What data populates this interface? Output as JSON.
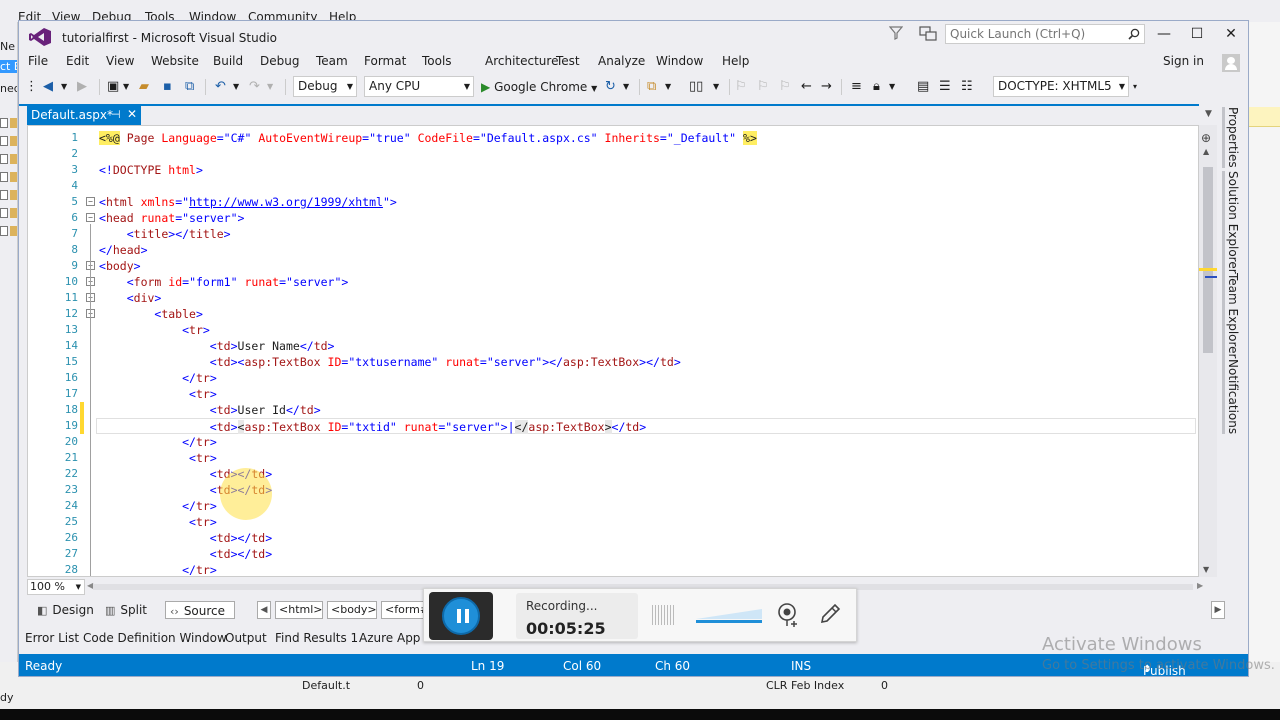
{
  "background_window": {
    "menu": [
      "Edit",
      "View",
      "Debug",
      "Tools",
      "Window",
      "Community",
      "Help"
    ],
    "left_fragments": [
      "Ne",
      "ct E",
      "ned"
    ],
    "bottom_fragments": [
      "dy",
      "Default.t",
      "0",
      "CLR Feb Index",
      "0"
    ]
  },
  "titlebar": {
    "title": "tutorialfirst - Microsoft Visual Studio",
    "quick_launch_placeholder": "Quick Launch (Ctrl+Q)",
    "minimize": "—",
    "maximize": "☐",
    "close": "✕"
  },
  "menubar": {
    "items": [
      "File",
      "Edit",
      "View",
      "Website",
      "Build",
      "Debug",
      "Team",
      "Format",
      "Tools",
      "Architecture",
      "Test",
      "Analyze",
      "Window",
      "Help"
    ],
    "sign_in": "Sign in"
  },
  "toolbar": {
    "config": "Debug",
    "platform": "Any CPU",
    "run_target": "Google Chrome",
    "doctype": "DOCTYPE: XHTML5"
  },
  "doc_tab": {
    "name": "Default.aspx*",
    "pin": "⊣",
    "close": "✕"
  },
  "editor": {
    "line_numbers": [
      "1",
      "2",
      "3",
      "4",
      "5",
      "6",
      "7",
      "8",
      "9",
      "10",
      "11",
      "12",
      "13",
      "14",
      "15",
      "16",
      "17",
      "18",
      "19",
      "20",
      "21",
      "22",
      "23",
      "24",
      "25",
      "26",
      "27",
      "28"
    ],
    "lines": [
      [
        [
          "c-dir",
          "<%@"
        ],
        [
          "c-black",
          " "
        ],
        [
          "c-maroon",
          "Page"
        ],
        [
          "c-black",
          " "
        ],
        [
          "c-red",
          "Language"
        ],
        [
          "c-blue",
          "=\"C#\""
        ],
        [
          "c-black",
          " "
        ],
        [
          "c-red",
          "AutoEventWireup"
        ],
        [
          "c-blue",
          "=\"true\""
        ],
        [
          "c-black",
          " "
        ],
        [
          "c-red",
          "CodeFile"
        ],
        [
          "c-blue",
          "=\"Default.aspx.cs\""
        ],
        [
          "c-black",
          " "
        ],
        [
          "c-red",
          "Inherits"
        ],
        [
          "c-blue",
          "=\"_Default\""
        ],
        [
          "c-black",
          " "
        ],
        [
          "c-dir",
          "%>"
        ]
      ],
      [],
      [
        [
          "c-blue",
          "<!"
        ],
        [
          "c-maroon",
          "DOCTYPE"
        ],
        [
          "c-black",
          " "
        ],
        [
          "c-red",
          "html"
        ],
        [
          "c-blue",
          ">"
        ]
      ],
      [],
      [
        [
          "c-blue",
          "<"
        ],
        [
          "c-maroon",
          "html"
        ],
        [
          "c-black",
          " "
        ],
        [
          "c-red",
          "xmlns"
        ],
        [
          "c-blue",
          "=\""
        ],
        [
          "c-link",
          "http://www.w3.org/1999/xhtml"
        ],
        [
          "c-blue",
          "\">"
        ]
      ],
      [
        [
          "c-blue",
          "<"
        ],
        [
          "c-maroon",
          "head"
        ],
        [
          "c-black",
          " "
        ],
        [
          "c-red",
          "runat"
        ],
        [
          "c-blue",
          "=\"server\">"
        ]
      ],
      [
        [
          "c-black",
          "    "
        ],
        [
          "c-blue",
          "<"
        ],
        [
          "c-maroon",
          "title"
        ],
        [
          "c-blue",
          "></"
        ],
        [
          "c-maroon",
          "title"
        ],
        [
          "c-blue",
          ">"
        ]
      ],
      [
        [
          "c-blue",
          "</"
        ],
        [
          "c-maroon",
          "head"
        ],
        [
          "c-blue",
          ">"
        ]
      ],
      [
        [
          "c-blue",
          "<"
        ],
        [
          "c-maroon",
          "body"
        ],
        [
          "c-blue",
          ">"
        ]
      ],
      [
        [
          "c-black",
          "    "
        ],
        [
          "c-blue",
          "<"
        ],
        [
          "c-maroon",
          "form"
        ],
        [
          "c-black",
          " "
        ],
        [
          "c-red",
          "id"
        ],
        [
          "c-blue",
          "=\"form1\""
        ],
        [
          "c-black",
          " "
        ],
        [
          "c-red",
          "runat"
        ],
        [
          "c-blue",
          "=\"server\">"
        ]
      ],
      [
        [
          "c-black",
          "    "
        ],
        [
          "c-blue",
          "<"
        ],
        [
          "c-maroon",
          "div"
        ],
        [
          "c-blue",
          ">"
        ]
      ],
      [
        [
          "c-black",
          "        "
        ],
        [
          "c-blue",
          "<"
        ],
        [
          "c-maroon",
          "table"
        ],
        [
          "c-blue",
          ">"
        ]
      ],
      [
        [
          "c-black",
          "            "
        ],
        [
          "c-blue",
          "<"
        ],
        [
          "c-maroon",
          "tr"
        ],
        [
          "c-blue",
          ">"
        ]
      ],
      [
        [
          "c-black",
          "                "
        ],
        [
          "c-blue",
          "<"
        ],
        [
          "c-maroon",
          "td"
        ],
        [
          "c-blue",
          ">"
        ],
        [
          "c-black",
          "User Name"
        ],
        [
          "c-blue",
          "</"
        ],
        [
          "c-maroon",
          "td"
        ],
        [
          "c-blue",
          ">"
        ]
      ],
      [
        [
          "c-black",
          "                "
        ],
        [
          "c-blue",
          "<"
        ],
        [
          "c-maroon",
          "td"
        ],
        [
          "c-blue",
          "><"
        ],
        [
          "c-maroon",
          "asp:TextBox"
        ],
        [
          "c-black",
          " "
        ],
        [
          "c-red",
          "ID"
        ],
        [
          "c-blue",
          "=\"txtusername\""
        ],
        [
          "c-black",
          " "
        ],
        [
          "c-red",
          "runat"
        ],
        [
          "c-blue",
          "=\"server\"></"
        ],
        [
          "c-maroon",
          "asp:TextBox"
        ],
        [
          "c-blue",
          "></"
        ],
        [
          "c-maroon",
          "td"
        ],
        [
          "c-blue",
          ">"
        ]
      ],
      [
        [
          "c-black",
          "            "
        ],
        [
          "c-blue",
          "</"
        ],
        [
          "c-maroon",
          "tr"
        ],
        [
          "c-blue",
          ">"
        ]
      ],
      [
        [
          "c-black",
          "             "
        ],
        [
          "c-blue",
          "<"
        ],
        [
          "c-maroon",
          "tr"
        ],
        [
          "c-blue",
          ">"
        ]
      ],
      [
        [
          "c-black",
          "                "
        ],
        [
          "c-blue",
          "<"
        ],
        [
          "c-maroon",
          "td"
        ],
        [
          "c-blue",
          ">"
        ],
        [
          "c-black",
          "User Id"
        ],
        [
          "c-blue",
          "</"
        ],
        [
          "c-maroon",
          "td"
        ],
        [
          "c-blue",
          ">"
        ]
      ],
      [
        [
          "c-black",
          "                "
        ],
        [
          "c-blue",
          "<"
        ],
        [
          "c-maroon",
          "td"
        ],
        [
          "c-blue",
          ">"
        ],
        [
          "c-hl",
          "<"
        ],
        [
          "c-maroon",
          "asp:TextBox"
        ],
        [
          "c-black",
          " "
        ],
        [
          "c-red",
          "ID"
        ],
        [
          "c-blue",
          "=\"txtid\""
        ],
        [
          "c-black",
          " "
        ],
        [
          "c-red",
          "runat"
        ],
        [
          "c-blue",
          "=\"server\">|"
        ],
        [
          "c-hl",
          "</"
        ],
        [
          "c-maroon",
          "asp:TextBox"
        ],
        [
          "c-hl",
          ">"
        ],
        [
          "c-blue",
          "</"
        ],
        [
          "c-maroon",
          "td"
        ],
        [
          "c-blue",
          ">"
        ]
      ],
      [
        [
          "c-black",
          "            "
        ],
        [
          "c-blue",
          "</"
        ],
        [
          "c-maroon",
          "tr"
        ],
        [
          "c-blue",
          ">"
        ]
      ],
      [
        [
          "c-black",
          "             "
        ],
        [
          "c-blue",
          "<"
        ],
        [
          "c-maroon",
          "tr"
        ],
        [
          "c-blue",
          ">"
        ]
      ],
      [
        [
          "c-black",
          "                "
        ],
        [
          "c-blue",
          "<"
        ],
        [
          "c-maroon",
          "td"
        ],
        [
          "c-blue",
          "></"
        ],
        [
          "c-maroon",
          "td"
        ],
        [
          "c-blue",
          ">"
        ]
      ],
      [
        [
          "c-black",
          "                "
        ],
        [
          "c-blue",
          "<"
        ],
        [
          "c-maroon",
          "td"
        ],
        [
          "c-blue",
          "></"
        ],
        [
          "c-maroon",
          "td"
        ],
        [
          "c-blue",
          ">"
        ]
      ],
      [
        [
          "c-black",
          "            "
        ],
        [
          "c-blue",
          "</"
        ],
        [
          "c-maroon",
          "tr"
        ],
        [
          "c-blue",
          ">"
        ]
      ],
      [
        [
          "c-black",
          "             "
        ],
        [
          "c-blue",
          "<"
        ],
        [
          "c-maroon",
          "tr"
        ],
        [
          "c-blue",
          ">"
        ]
      ],
      [
        [
          "c-black",
          "                "
        ],
        [
          "c-blue",
          "<"
        ],
        [
          "c-maroon",
          "td"
        ],
        [
          "c-blue",
          "></"
        ],
        [
          "c-maroon",
          "td"
        ],
        [
          "c-blue",
          ">"
        ]
      ],
      [
        [
          "c-black",
          "                "
        ],
        [
          "c-blue",
          "<"
        ],
        [
          "c-maroon",
          "td"
        ],
        [
          "c-blue",
          "></"
        ],
        [
          "c-maroon",
          "td"
        ],
        [
          "c-blue",
          ">"
        ]
      ],
      [
        [
          "c-black",
          "            "
        ],
        [
          "c-blue",
          "</"
        ],
        [
          "c-maroon",
          "tr"
        ],
        [
          "c-blue",
          ">"
        ]
      ]
    ],
    "current_line": 19,
    "changed_lines": [
      18,
      19
    ],
    "fold_lines": [
      5,
      6,
      9,
      10,
      11,
      12
    ]
  },
  "side_tabs": [
    "Properties",
    "Solution Explorer",
    "Team Explorer",
    "Notifications"
  ],
  "zoom": "100 %",
  "view_tabs": [
    "Design",
    "Split",
    "Source"
  ],
  "active_view": "Source",
  "breadcrumbs": [
    "<html>",
    "<body>",
    "<form#form1>"
  ],
  "bottom_tabs": [
    "Error List",
    "Code Definition Window",
    "Output",
    "Find Results 1",
    "Azure App S"
  ],
  "statusbar": {
    "state": "Ready",
    "line": "Ln 19",
    "col": "Col 60",
    "ch": "Ch 60",
    "mode": "INS",
    "publish": "Publish"
  },
  "watermark": {
    "title": "Activate Windows",
    "subtitle": "Go to Settings to activate Windows."
  },
  "recorder": {
    "label": "Recording...",
    "time": "00:05:25"
  },
  "colors": {
    "accent": "#007acc",
    "line_number": "#2b91af",
    "tag": "#a31515",
    "attribute": "#ff0000",
    "value": "#0000ff",
    "change_bar": "#ffd830"
  }
}
